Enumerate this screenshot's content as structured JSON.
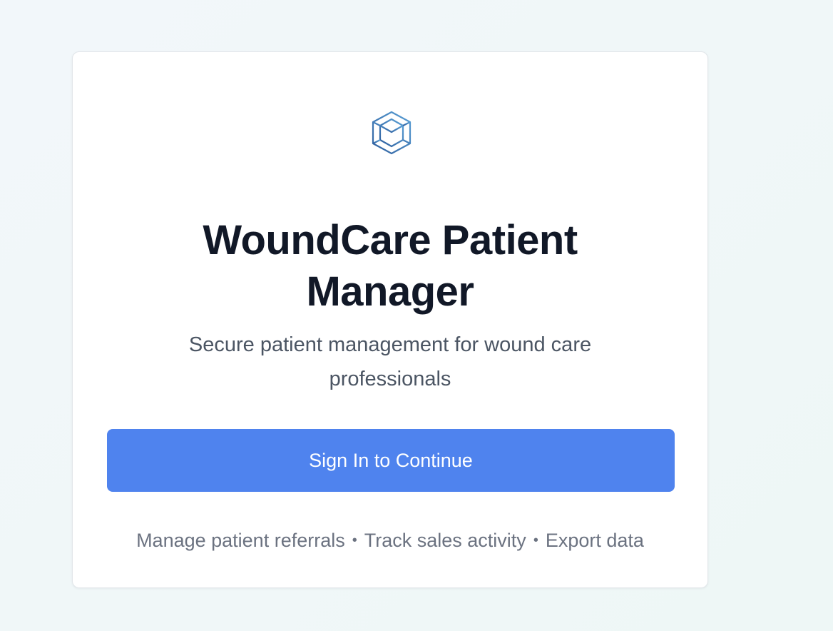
{
  "app": {
    "title": "WoundCare Patient Manager",
    "subtitle": "Secure patient management for wound care professionals",
    "logo_icon": "hexagon-cube-icon"
  },
  "actions": {
    "signin_label": "Sign In to Continue"
  },
  "features": {
    "items": [
      "Manage patient referrals",
      "Track sales activity",
      "Export data"
    ],
    "separator": "•"
  },
  "colors": {
    "primary": "#4f83ee",
    "title": "#111827",
    "subtitle": "#4b5563",
    "muted": "#6b7280",
    "logo_light": "#5aa0d6",
    "logo_dark": "#2f5f9e"
  }
}
